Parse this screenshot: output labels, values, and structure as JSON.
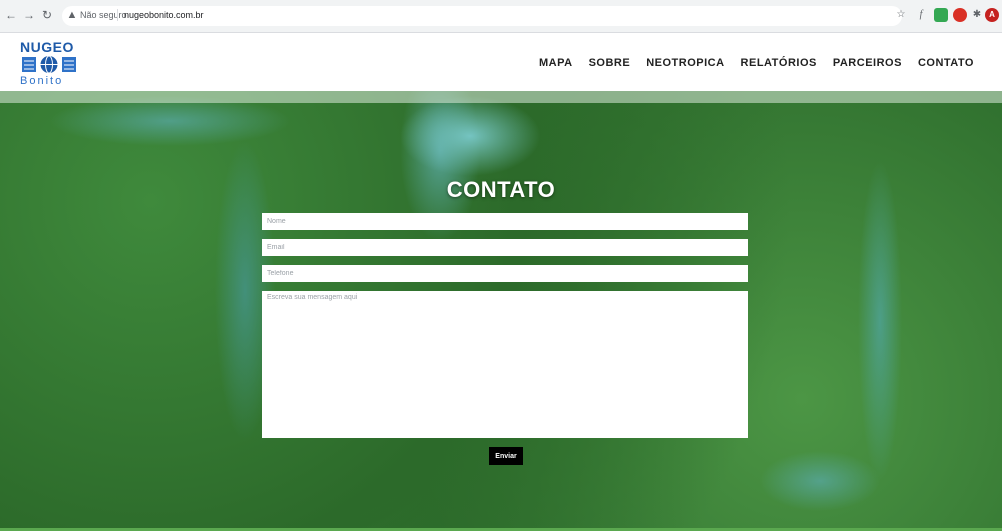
{
  "browser": {
    "security_label": "Não seguro",
    "url": "nugeobonito.com.br",
    "back_icon": "arrow-left-icon",
    "forward_icon": "arrow-right-icon",
    "reload_icon": "reload-icon",
    "warning_icon": "warning-icon",
    "profile_initial": "A"
  },
  "site": {
    "logo_top": "NUGEO",
    "logo_bottom": "Bonito",
    "brand_color": "#1e5aa8",
    "nav": [
      {
        "label": "MAPA"
      },
      {
        "label": "SOBRE"
      },
      {
        "label": "NEOTROPICA"
      },
      {
        "label": "RELATÓRIOS"
      },
      {
        "label": "PARCEIROS"
      },
      {
        "label": "CONTATO"
      }
    ]
  },
  "contact": {
    "title": "CONTATO",
    "name_placeholder": "Nome",
    "email_placeholder": "Email",
    "phone_placeholder": "Telefone",
    "message_placeholder": "Escreva sua mensagem aqui",
    "submit_label": "Enviar"
  }
}
